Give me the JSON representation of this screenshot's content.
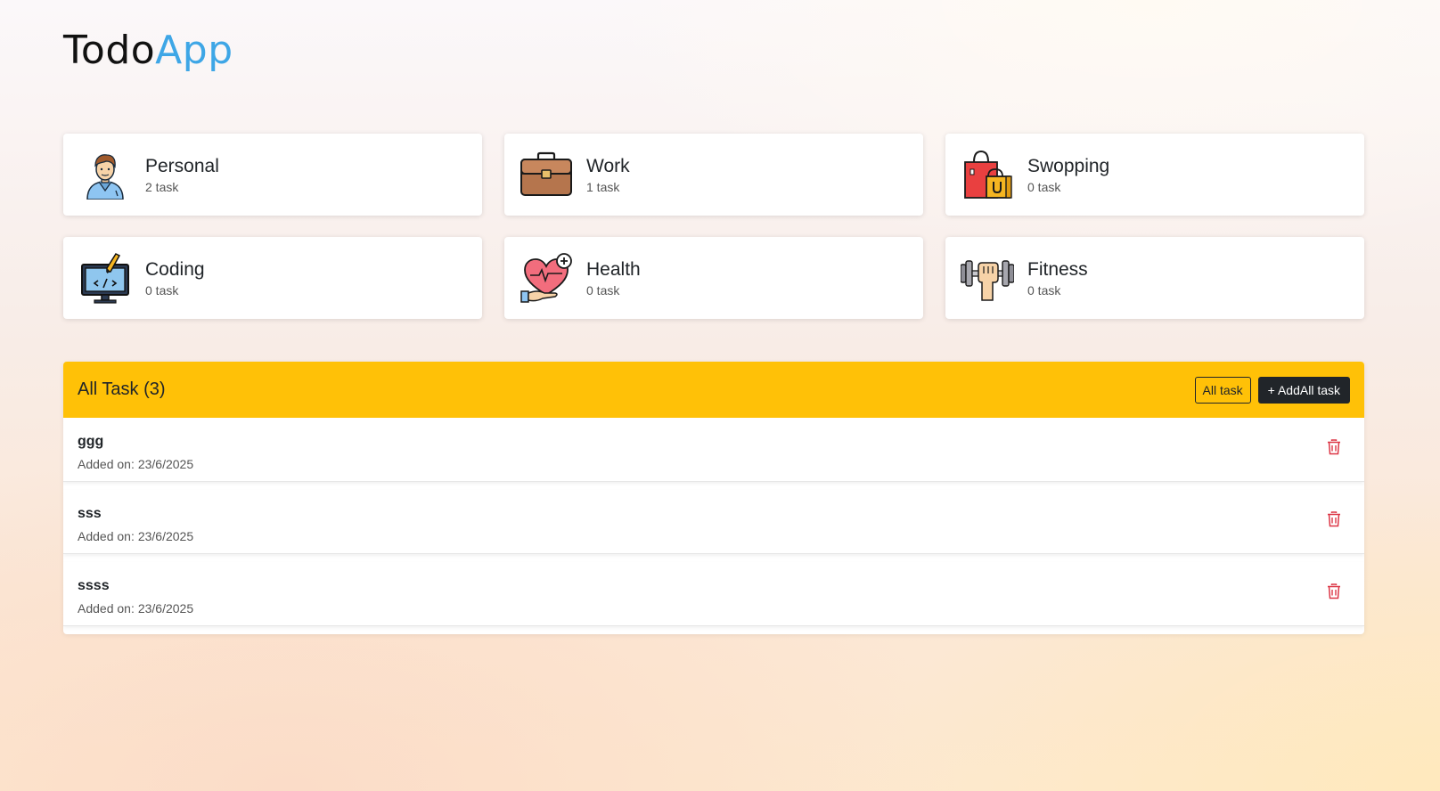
{
  "app": {
    "logo_part_1": "Todo",
    "logo_part_2": "App"
  },
  "categories": [
    {
      "name": "Personal",
      "count": "2 task",
      "icon": "person-icon"
    },
    {
      "name": "Work",
      "count": "1 task",
      "icon": "briefcase-icon"
    },
    {
      "name": "Swopping",
      "count": "0 task",
      "icon": "shopping-bags-icon"
    },
    {
      "name": "Coding",
      "count": "0 task",
      "icon": "monitor-code-icon"
    },
    {
      "name": "Health",
      "count": "0 task",
      "icon": "heart-hand-icon"
    },
    {
      "name": "Fitness",
      "count": "0 task",
      "icon": "dumbbell-icon"
    }
  ],
  "tasks_panel": {
    "title": "All Task (3)",
    "filter_button_label": "All task",
    "add_button_label": "+ AddAll task",
    "header_color": "#ffc107"
  },
  "tasks": [
    {
      "name": "ggg",
      "date_label": "Added on:",
      "date": "23/6/2025"
    },
    {
      "name": "sss",
      "date_label": "Added on:",
      "date": "23/6/2025"
    },
    {
      "name": "ssss",
      "date_label": "Added on:",
      "date": "23/6/2025"
    }
  ],
  "colors": {
    "logo_accent": "#3ea6e6",
    "delete_icon": "#dc3545",
    "dark_button": "#212529"
  }
}
